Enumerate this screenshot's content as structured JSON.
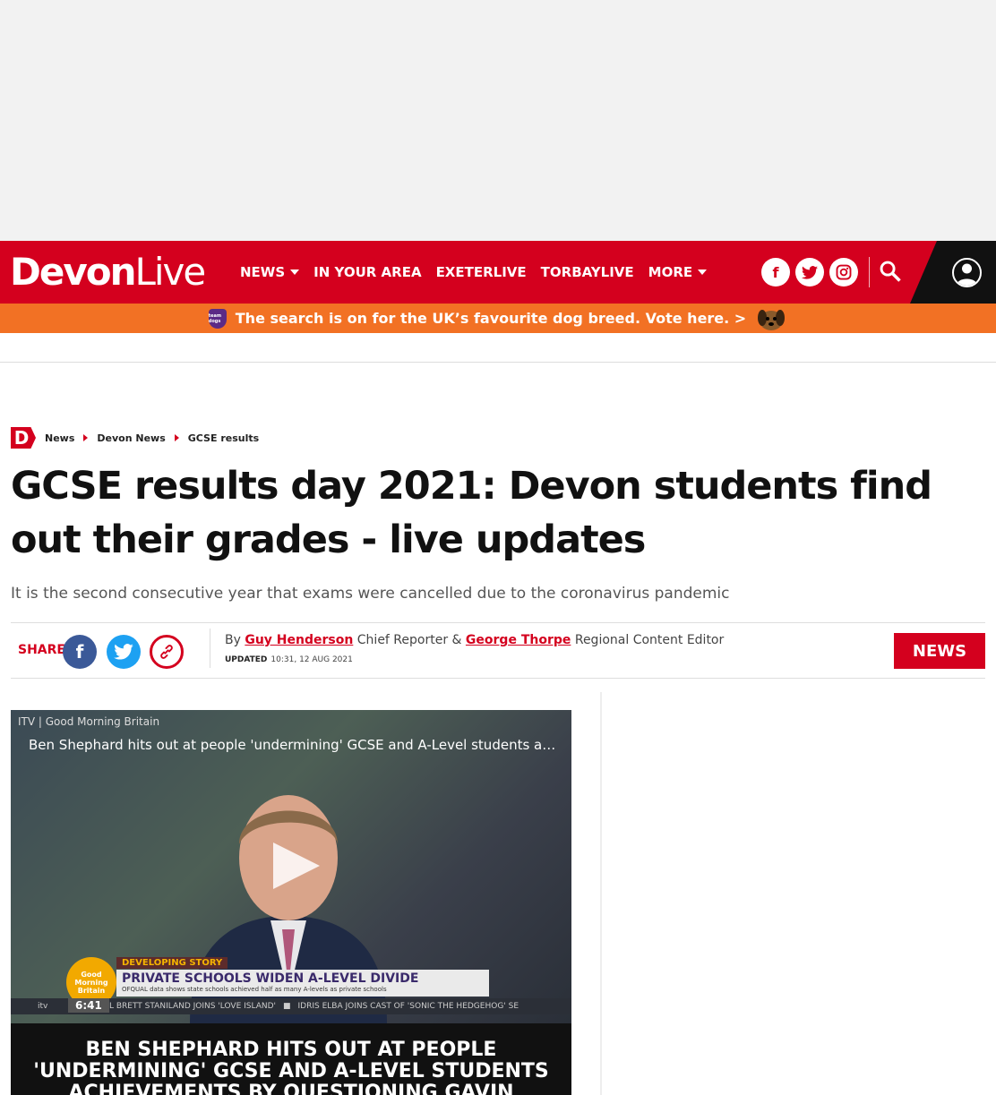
{
  "brand": {
    "name_bold": "Devon",
    "name_light": "Live",
    "accent": "#d4001e"
  },
  "nav": {
    "items": [
      {
        "label": "NEWS",
        "has_caret": true
      },
      {
        "label": "IN YOUR AREA",
        "has_caret": false
      },
      {
        "label": "EXETERLIVE",
        "has_caret": false
      },
      {
        "label": "TORBAYLIVE",
        "has_caret": false
      },
      {
        "label": "MORE",
        "has_caret": true
      }
    ]
  },
  "social": {
    "facebook": "f",
    "twitter": "twitter-icon",
    "instagram": "instagram-icon"
  },
  "promo": {
    "badge": "team dogs",
    "text": "The search is on for the UK’s favourite dog breed. Vote here. >"
  },
  "breadcrumb": {
    "logo": "D",
    "items": [
      "News",
      "Devon News",
      "GCSE results"
    ]
  },
  "article": {
    "headline": "GCSE results day 2021: Devon students find out their grades - live updates",
    "standfirst": "It is the second consecutive year that exams were cancelled due to the coronavirus pandemic",
    "share_label": "SHARE",
    "byline_prefix": "By",
    "author1": "Guy Henderson",
    "author1_role": "Chief Reporter &",
    "author2": "George Thorpe",
    "author2_role": "Regional Content Editor",
    "updated_label": "UPDATED",
    "updated_time": "10:31, 12 AUG 2021",
    "section_tag": "NEWS"
  },
  "video": {
    "source": "ITV | Good Morning Britain",
    "title": "Ben Shephard hits out at people 'undermining' GCSE and A-Level students achievements by questioning Gavin Williamson",
    "gmb_logo": "Good Morning Britain",
    "developing": "DEVELOPING STORY",
    "lower_third_headline": "PRIVATE SCHOOLS WIDEN A-LEVEL DIVIDE",
    "lower_third_sub": "OFQUAL data shows state schools achieved half as many A-levels as private schools",
    "ticker_logo": "itv",
    "ticker_1": "DEL BRETT STANILAND JOINS 'LOVE ISLAND'",
    "ticker_2": "IDRIS ELBA JOINS CAST OF 'SONIC THE HEDGEHOG' SE",
    "duration": "6:41",
    "caption": "BEN SHEPHARD HITS OUT AT PEOPLE 'UNDERMINING' GCSE AND A-LEVEL STUDENTS ACHIEVEMENTS BY QUESTIONING GAVIN WILLIAMSON"
  }
}
